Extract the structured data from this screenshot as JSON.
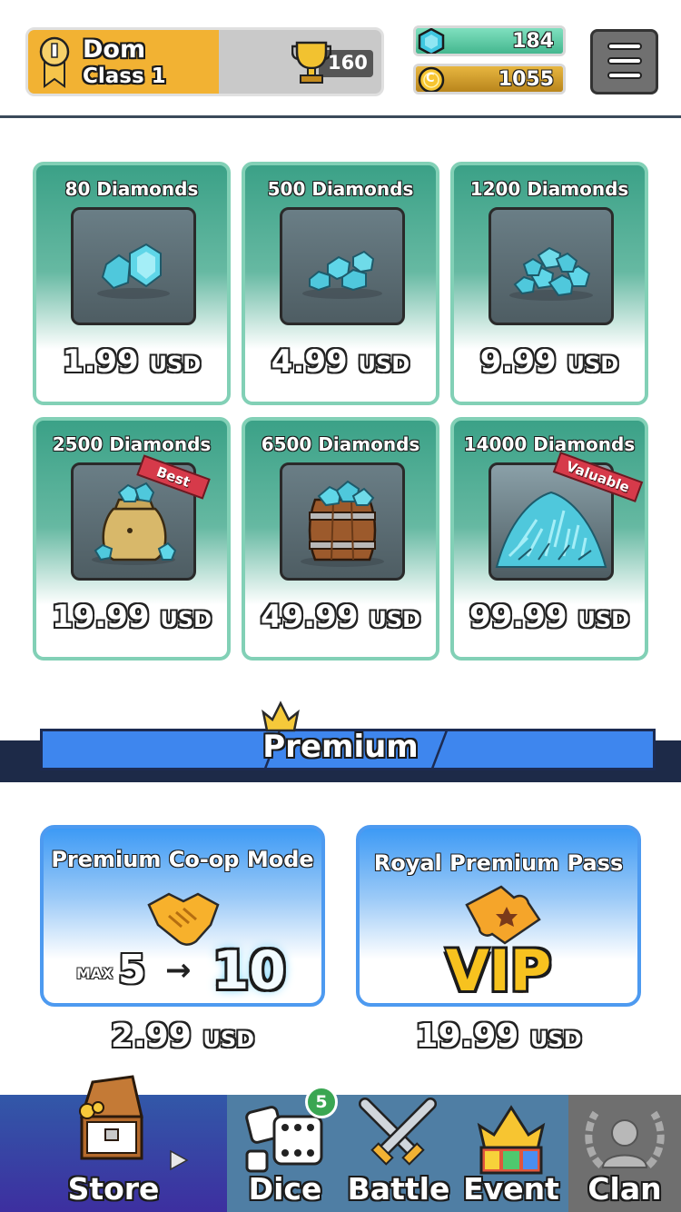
{
  "header": {
    "player_name": "Dom",
    "player_class": "Class 1",
    "trophies": "160",
    "gems": "184",
    "coins": "1055",
    "coin_symbol": "C"
  },
  "diamond_packs": [
    {
      "title": "80 Diamonds",
      "price": "1.99",
      "currency": "USD",
      "tag": ""
    },
    {
      "title": "500 Diamonds",
      "price": "4.99",
      "currency": "USD",
      "tag": ""
    },
    {
      "title": "1200 Diamonds",
      "price": "9.99",
      "currency": "USD",
      "tag": ""
    },
    {
      "title": "2500 Diamonds",
      "price": "19.99",
      "currency": "USD",
      "tag": "Best"
    },
    {
      "title": "6500 Diamonds",
      "price": "49.99",
      "currency": "USD",
      "tag": ""
    },
    {
      "title": "14000 Diamonds",
      "price": "99.99",
      "currency": "USD",
      "tag": "Valuable"
    }
  ],
  "premium": {
    "section_title": "Premium",
    "coop": {
      "title": "Premium Co-op Mode",
      "max_label": "MAX",
      "from": "5",
      "arrow": "→",
      "to": "10",
      "price": "2.99",
      "currency": "USD"
    },
    "vip": {
      "title": "Royal Premium Pass",
      "vip_label": "VIP",
      "price": "19.99",
      "currency": "USD"
    }
  },
  "nav": {
    "store": "Store",
    "dice": "Dice",
    "dice_badge": "5",
    "battle": "Battle",
    "event": "Event",
    "clan": "Clan"
  },
  "colors": {
    "diamond_card": "#3ba187",
    "premium_blue": "#3e86ee",
    "nav_bg": "#4f7ea4",
    "store_active": "#3d2fa0"
  }
}
